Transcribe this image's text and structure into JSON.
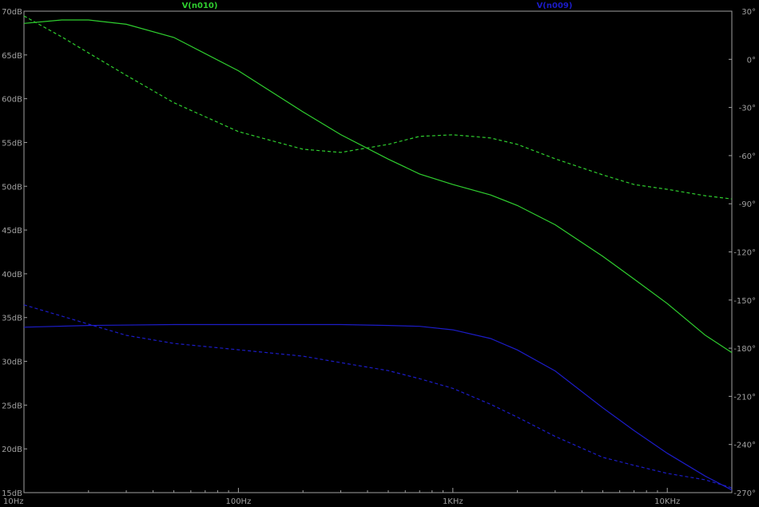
{
  "chart_data": {
    "type": "line",
    "x_scale": "log",
    "x_range": [
      10,
      20000
    ],
    "y_left_range": [
      15,
      70
    ],
    "y_right_range": [
      -270,
      30
    ],
    "grid": false,
    "background": "#000000",
    "axis_color": "#a0a0a0",
    "x_ticks": [
      {
        "value": 10,
        "label": "10Hz"
      },
      {
        "value": 100,
        "label": "100Hz"
      },
      {
        "value": 1000,
        "label": "1KHz"
      },
      {
        "value": 10000,
        "label": "10KHz"
      }
    ],
    "y_left_ticks": [
      {
        "value": 70,
        "label": "70dB"
      },
      {
        "value": 65,
        "label": "65dB"
      },
      {
        "value": 60,
        "label": "60dB"
      },
      {
        "value": 55,
        "label": "55dB"
      },
      {
        "value": 50,
        "label": "50dB"
      },
      {
        "value": 45,
        "label": "45dB"
      },
      {
        "value": 40,
        "label": "40dB"
      },
      {
        "value": 35,
        "label": "35dB"
      },
      {
        "value": 30,
        "label": "30dB"
      },
      {
        "value": 25,
        "label": "25dB"
      },
      {
        "value": 20,
        "label": "20dB"
      },
      {
        "value": 15,
        "label": "15dB"
      }
    ],
    "y_right_ticks": [
      {
        "value": 30,
        "label": "30°"
      },
      {
        "value": 0,
        "label": "0°"
      },
      {
        "value": -30,
        "label": "-30°"
      },
      {
        "value": -60,
        "label": "-60°"
      },
      {
        "value": -90,
        "label": "-90°"
      },
      {
        "value": -120,
        "label": "-120°"
      },
      {
        "value": -150,
        "label": "-150°"
      },
      {
        "value": -180,
        "label": "-180°"
      },
      {
        "value": -210,
        "label": "-210°"
      },
      {
        "value": -240,
        "label": "-240°"
      },
      {
        "value": -270,
        "label": "-270°"
      }
    ],
    "series": [
      {
        "name": "V(n010)",
        "color": "#2fcf2f",
        "magnitude_db": [
          [
            10,
            68.6
          ],
          [
            15,
            69.0
          ],
          [
            20,
            69.0
          ],
          [
            30,
            68.5
          ],
          [
            50,
            67.0
          ],
          [
            100,
            63.2
          ],
          [
            200,
            58.5
          ],
          [
            300,
            55.9
          ],
          [
            500,
            53.1
          ],
          [
            700,
            51.4
          ],
          [
            1000,
            50.2
          ],
          [
            1500,
            49.0
          ],
          [
            2000,
            47.8
          ],
          [
            3000,
            45.6
          ],
          [
            5000,
            42.0
          ],
          [
            7000,
            39.4
          ],
          [
            10000,
            36.6
          ],
          [
            15000,
            33.0
          ],
          [
            20000,
            31.0
          ]
        ],
        "phase_deg": [
          [
            10,
            27
          ],
          [
            15,
            14
          ],
          [
            20,
            4
          ],
          [
            30,
            -10
          ],
          [
            50,
            -27
          ],
          [
            100,
            -45
          ],
          [
            200,
            -56
          ],
          [
            300,
            -58
          ],
          [
            500,
            -53
          ],
          [
            700,
            -48
          ],
          [
            1000,
            -47
          ],
          [
            1500,
            -49
          ],
          [
            2000,
            -53
          ],
          [
            3000,
            -62
          ],
          [
            5000,
            -72
          ],
          [
            7000,
            -78
          ],
          [
            10000,
            -81
          ],
          [
            15000,
            -85
          ],
          [
            20000,
            -87
          ]
        ]
      },
      {
        "name": "V(n009)",
        "color": "#1c1cc8",
        "magnitude_db": [
          [
            10,
            33.9
          ],
          [
            20,
            34.1
          ],
          [
            50,
            34.2
          ],
          [
            100,
            34.2
          ],
          [
            300,
            34.2
          ],
          [
            500,
            34.1
          ],
          [
            700,
            34.0
          ],
          [
            1000,
            33.6
          ],
          [
            1500,
            32.6
          ],
          [
            2000,
            31.3
          ],
          [
            3000,
            28.9
          ],
          [
            5000,
            24.7
          ],
          [
            7000,
            22.1
          ],
          [
            10000,
            19.5
          ],
          [
            15000,
            16.9
          ],
          [
            20000,
            15.3
          ]
        ],
        "phase_deg": [
          [
            10,
            -153
          ],
          [
            15,
            -160
          ],
          [
            20,
            -165
          ],
          [
            30,
            -172
          ],
          [
            50,
            -177
          ],
          [
            100,
            -181
          ],
          [
            200,
            -185
          ],
          [
            300,
            -189
          ],
          [
            500,
            -194
          ],
          [
            700,
            -199
          ],
          [
            1000,
            -205
          ],
          [
            1500,
            -215
          ],
          [
            2000,
            -223
          ],
          [
            3000,
            -235
          ],
          [
            5000,
            -248
          ],
          [
            7000,
            -253
          ],
          [
            10000,
            -258
          ],
          [
            15000,
            -262
          ],
          [
            20000,
            -267
          ]
        ]
      }
    ]
  }
}
